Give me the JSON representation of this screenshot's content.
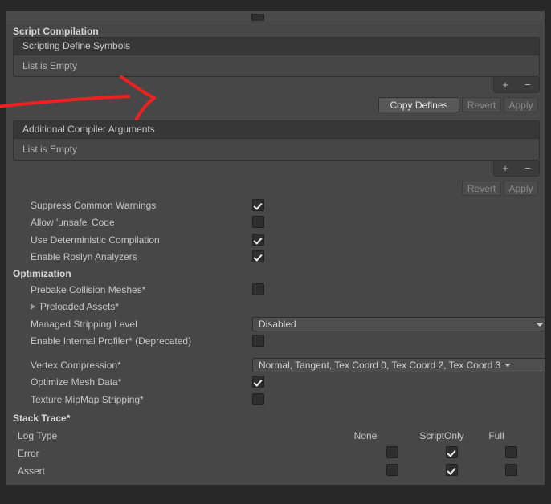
{
  "window": {
    "background_color": "#282828",
    "panel_color": "#474747"
  },
  "clipped_top_row": {
    "label": "",
    "checkbox_state": false
  },
  "sections": {
    "script_compilation": {
      "title": "Script Compilation",
      "lists": [
        {
          "header": "Scripting Define Symbols",
          "empty_text": "List is Empty",
          "add_label": "+",
          "remove_label": "−"
        },
        {
          "header": "Additional Compiler Arguments",
          "empty_text": "List is Empty",
          "add_label": "+",
          "remove_label": "−"
        }
      ],
      "buttons_row_1": [
        {
          "label": "Copy Defines",
          "enabled": true
        },
        {
          "label": "Revert",
          "enabled": false
        },
        {
          "label": "Apply",
          "enabled": false
        }
      ],
      "buttons_row_2": [
        {
          "label": "Revert",
          "enabled": false
        },
        {
          "label": "Apply",
          "enabled": false
        }
      ],
      "toggles": [
        {
          "label": "Suppress Common Warnings",
          "checked": true
        },
        {
          "label": "Allow 'unsafe' Code",
          "checked": false
        },
        {
          "label": "Use Deterministic Compilation",
          "checked": true
        },
        {
          "label": "Enable Roslyn Analyzers",
          "checked": true
        }
      ]
    },
    "optimization": {
      "title": "Optimization",
      "rows": [
        {
          "type": "toggle",
          "label": "Prebake Collision Meshes*",
          "checked": false
        },
        {
          "type": "foldout",
          "label": "Preloaded Assets*",
          "expanded": false
        },
        {
          "type": "popup",
          "label": "Managed Stripping Level",
          "value": "Disabled"
        },
        {
          "type": "toggle",
          "label": "Enable Internal Profiler* (Deprecated)",
          "checked": false
        },
        {
          "type": "mask",
          "label": "Vertex Compression*",
          "value": "Normal, Tangent, Tex Coord 0, Tex Coord 2, Tex Coord 3"
        },
        {
          "type": "toggle",
          "label": "Optimize Mesh Data*",
          "checked": true
        },
        {
          "type": "toggle",
          "label": "Texture MipMap Stripping*",
          "checked": false
        }
      ]
    },
    "stack_trace": {
      "title": "Stack Trace*",
      "row_header_label": "Log Type",
      "columns": [
        "None",
        "ScriptOnly",
        "Full"
      ],
      "rows": [
        {
          "label": "Error",
          "selected": "ScriptOnly"
        },
        {
          "label": "Assert",
          "selected": "ScriptOnly"
        }
      ]
    }
  },
  "annotation": {
    "type": "hand-drawn-arrow",
    "color": "#ee2020"
  }
}
